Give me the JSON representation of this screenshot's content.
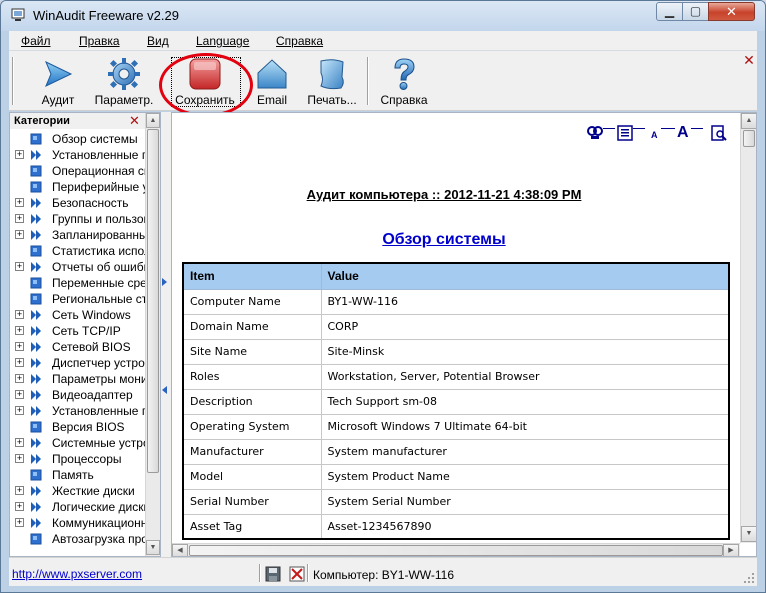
{
  "window": {
    "title": "WinAudit Freeware v2.29",
    "close_glyph": "✕",
    "min_glyph": "▁",
    "max_glyph": "▢"
  },
  "menu": [
    {
      "label": "Файл"
    },
    {
      "label": "Правка"
    },
    {
      "label": "Вид"
    },
    {
      "label": "Language"
    },
    {
      "label": "Справка"
    }
  ],
  "toolbar": {
    "items": [
      {
        "label": "Аудит",
        "icon": "play-arrow-icon"
      },
      {
        "label": "Параметр.",
        "icon": "gear-icon"
      },
      {
        "label": "Сохранить",
        "icon": "save-icon"
      },
      {
        "label": "Email",
        "icon": "email-icon"
      },
      {
        "label": "Печать...",
        "icon": "print-icon"
      },
      {
        "label": "Справка",
        "icon": "help-icon"
      }
    ],
    "close_glyph": "✕"
  },
  "categories": {
    "title": "Категории",
    "close_glyph": "✕",
    "items": [
      {
        "label": "Обзор системы",
        "expandable": false
      },
      {
        "label": "Установленные программы",
        "expandable": true
      },
      {
        "label": "Операционная система",
        "expandable": false
      },
      {
        "label": "Периферийные устройства",
        "expandable": false
      },
      {
        "label": "Безопасность",
        "expandable": true
      },
      {
        "label": "Группы и пользователи",
        "expandable": true
      },
      {
        "label": "Запланированные задачи",
        "expandable": true
      },
      {
        "label": "Статистика использования",
        "expandable": false
      },
      {
        "label": "Отчеты об ошибках",
        "expandable": true
      },
      {
        "label": "Переменные среды",
        "expandable": false
      },
      {
        "label": "Региональные стандарты",
        "expandable": false
      },
      {
        "label": "Сеть Windows",
        "expandable": true
      },
      {
        "label": "Сеть TCP/IP",
        "expandable": true
      },
      {
        "label": "Сетевой BIOS",
        "expandable": true
      },
      {
        "label": "Диспетчер устройств",
        "expandable": true
      },
      {
        "label": "Параметры монитора",
        "expandable": true
      },
      {
        "label": "Видеоадаптер",
        "expandable": true
      },
      {
        "label": "Установленные принтеры",
        "expandable": true
      },
      {
        "label": "Версия BIOS",
        "expandable": false
      },
      {
        "label": "Системные устройства",
        "expandable": true
      },
      {
        "label": "Процессоры",
        "expandable": true
      },
      {
        "label": "Память",
        "expandable": false
      },
      {
        "label": "Жесткие диски",
        "expandable": true
      },
      {
        "label": "Логические диски",
        "expandable": true
      },
      {
        "label": "Коммуникационные порты",
        "expandable": true
      },
      {
        "label": "Автозагрузка программ",
        "expandable": false
      }
    ]
  },
  "report": {
    "tools": [
      "A",
      "A"
    ],
    "title": "Аудит компьютера :: 2012-11-21 4:38:09 PM",
    "section": "Обзор системы",
    "columns": [
      "Item",
      "Value"
    ],
    "rows": [
      [
        "Computer Name",
        "BY1-WW-116"
      ],
      [
        "Domain Name",
        "CORP"
      ],
      [
        "Site Name",
        "Site-Minsk"
      ],
      [
        "Roles",
        "Workstation, Server, Potential Browser"
      ],
      [
        "Description",
        "Tech Support sm-08"
      ],
      [
        "Operating System",
        "Microsoft Windows 7 Ultimate 64-bit"
      ],
      [
        "Manufacturer",
        "System manufacturer"
      ],
      [
        "Model",
        "System Product Name"
      ],
      [
        "Serial Number",
        "System Serial Number"
      ],
      [
        "Asset Tag",
        "Asset-1234567890"
      ]
    ]
  },
  "status": {
    "link": "http://www.pxserver.com",
    "text": "Компьютер: BY1-WW-116"
  },
  "colors": {
    "accent": "#0000cc",
    "header_blue": "#a6cbf0",
    "highlight": "#e3000f"
  }
}
